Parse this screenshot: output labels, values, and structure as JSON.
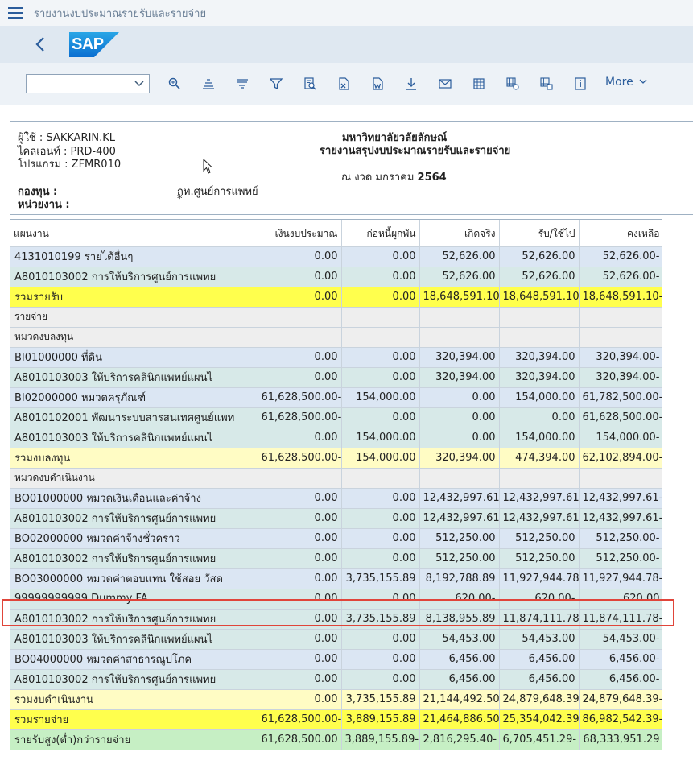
{
  "app": {
    "title": "รายงานงบประมาณรายรับและรายจ่าย",
    "logo_text": "SAP"
  },
  "toolbar": {
    "layout_value": "",
    "more_label": "More",
    "icons": [
      "find-icon",
      "sort-ascending-icon",
      "sort-descending-icon",
      "filter-icon",
      "print-preview-icon",
      "export-spreadsheet-icon",
      "word-processing-icon",
      "download-icon",
      "send-mail-icon",
      "abc-analysis-icon",
      "change-layout-icon",
      "select-layout-icon",
      "details-icon"
    ]
  },
  "header": {
    "user_label": "ผู้ใช้ : SAKKARIN.KL",
    "client_label": "ไคลเอนท์ : PRD-400",
    "program_label": "โปรแกรม : ZFMR010",
    "university": "มหาวิทยาลัยวลัยลักษณ์",
    "report_title": "รายงานสรุปงบประมาณรายรับและรายจ่าย",
    "period_prefix": "ณ งวด มกราคม ",
    "period_year": "2564",
    "fund_label": "กองทุน :",
    "fund_value": "กท.ศูนย์การแพทย์",
    "unit_label": "หน่วยงาน :",
    "unit_value": "*"
  },
  "table": {
    "columns": [
      "แผนงาน",
      "เงินงบประมาณ",
      "ก่อหนี้ผูกพัน",
      "เกิดจริง",
      "รับ/ใช้ไป",
      "คงเหลือ"
    ],
    "rows": [
      {
        "kind": "blue",
        "cells": [
          "4131010199 รายได้อื่นๆ",
          "0.00",
          "0.00",
          "52,626.00",
          "52,626.00",
          "52,626.00-"
        ]
      },
      {
        "kind": "teal",
        "cells": [
          "A8010103002  การให้บริการศูนย์การแพทย",
          "0.00",
          "0.00",
          "52,626.00",
          "52,626.00",
          "52,626.00-"
        ]
      },
      {
        "kind": "yellow",
        "cells": [
          "รวมรายรับ",
          "0.00",
          "0.00",
          "18,648,591.10",
          "18,648,591.10",
          "18,648,591.10-"
        ]
      },
      {
        "kind": "gray",
        "cells": [
          "รายจ่าย",
          "",
          "",
          "",
          "",
          ""
        ]
      },
      {
        "kind": "gray",
        "cells": [
          "หมวดงบลงทุน",
          "",
          "",
          "",
          "",
          ""
        ]
      },
      {
        "kind": "blue",
        "cells": [
          "BI01000000 ที่ดิน",
          "0.00",
          "0.00",
          "320,394.00",
          "320,394.00",
          "320,394.00-"
        ]
      },
      {
        "kind": "teal",
        "cells": [
          "A8010103003  ให้บริการคลินิกแพทย์แผนไ",
          "0.00",
          "0.00",
          "320,394.00",
          "320,394.00",
          "320,394.00-"
        ]
      },
      {
        "kind": "blue",
        "cells": [
          "BI02000000 หมวดครุภัณฑ์",
          "61,628,500.00-",
          "154,000.00",
          "0.00",
          "154,000.00",
          "61,782,500.00-"
        ]
      },
      {
        "kind": "teal",
        "cells": [
          "A8010102001 พัฒนาระบบสารสนเทศศูนย์แพท",
          "61,628,500.00-",
          "0.00",
          "0.00",
          "0.00",
          "61,628,500.00-"
        ]
      },
      {
        "kind": "teal",
        "cells": [
          "A8010103003  ให้บริการคลินิกแพทย์แผนไ",
          "0.00",
          "154,000.00",
          "0.00",
          "154,000.00",
          "154,000.00-"
        ]
      },
      {
        "kind": "lightyellow",
        "cells": [
          "รวมงบลงทุน",
          "61,628,500.00-",
          "154,000.00",
          "320,394.00",
          "474,394.00",
          "62,102,894.00-"
        ]
      },
      {
        "kind": "gray",
        "cells": [
          "หมวดงบดำเนินงาน",
          "",
          "",
          "",
          "",
          ""
        ]
      },
      {
        "kind": "blue",
        "cells": [
          "BO01000000 หมวดเงินเดือนและค่าจ้าง",
          "0.00",
          "0.00",
          "12,432,997.61",
          "12,432,997.61",
          "12,432,997.61-"
        ]
      },
      {
        "kind": "teal",
        "cells": [
          "A8010103002  การให้บริการศูนย์การแพทย",
          "0.00",
          "0.00",
          "12,432,997.61",
          "12,432,997.61",
          "12,432,997.61-"
        ]
      },
      {
        "kind": "blue",
        "cells": [
          "BO02000000 หมวดค่าจ้างชั่วคราว",
          "0.00",
          "0.00",
          "512,250.00",
          "512,250.00",
          "512,250.00-"
        ]
      },
      {
        "kind": "teal",
        "cells": [
          "A8010103002  การให้บริการศูนย์การแพทย",
          "0.00",
          "0.00",
          "512,250.00",
          "512,250.00",
          "512,250.00-"
        ]
      },
      {
        "kind": "blue",
        "cells": [
          "BO03000000 หมวดค่าตอบแทน ใช้สอย วัสด",
          "0.00",
          "3,735,155.89",
          "8,192,788.89",
          "11,927,944.78",
          "11,927,944.78-"
        ]
      },
      {
        "kind": "teal",
        "cells": [
          "99999999999 Dummy FA",
          "0.00",
          "0.00",
          "620.00-",
          "620.00-",
          "620.00"
        ]
      },
      {
        "kind": "teal",
        "cells": [
          "A8010103002  การให้บริการศูนย์การแพทย",
          "0.00",
          "3,735,155.89",
          "8,138,955.89",
          "11,874,111.78",
          "11,874,111.78-"
        ]
      },
      {
        "kind": "teal",
        "cells": [
          "A8010103003  ให้บริการคลินิกแพทย์แผนไ",
          "0.00",
          "0.00",
          "54,453.00",
          "54,453.00",
          "54,453.00-"
        ]
      },
      {
        "kind": "blue",
        "cells": [
          "BO04000000 หมวดค่าสาธารณูปโภค",
          "0.00",
          "0.00",
          "6,456.00",
          "6,456.00",
          "6,456.00-"
        ]
      },
      {
        "kind": "teal",
        "cells": [
          "A8010103002  การให้บริการศูนย์การแพทย",
          "0.00",
          "0.00",
          "6,456.00",
          "6,456.00",
          "6,456.00-"
        ]
      },
      {
        "kind": "lightyellow",
        "cells": [
          "รวมงบดำเนินงาน",
          "0.00",
          "3,735,155.89",
          "21,144,492.50",
          "24,879,648.39",
          "24,879,648.39-"
        ]
      },
      {
        "kind": "yellow",
        "cells": [
          "รวมรายจ่าย",
          "61,628,500.00-",
          "3,889,155.89",
          "21,464,886.50",
          "25,354,042.39",
          "86,982,542.39-"
        ]
      },
      {
        "kind": "green",
        "cells": [
          "รายรับสูง(ต่ำ)กว่ารายจ่าย",
          "61,628,500.00",
          "3,889,155.89-",
          "2,816,295.40-",
          "6,705,451.29-",
          "68,333,951.29"
        ]
      }
    ]
  },
  "colors": {
    "shell_bg": "#dfe8f1",
    "brand": "#0a6ed1",
    "highlight_border": "#e0453a"
  }
}
